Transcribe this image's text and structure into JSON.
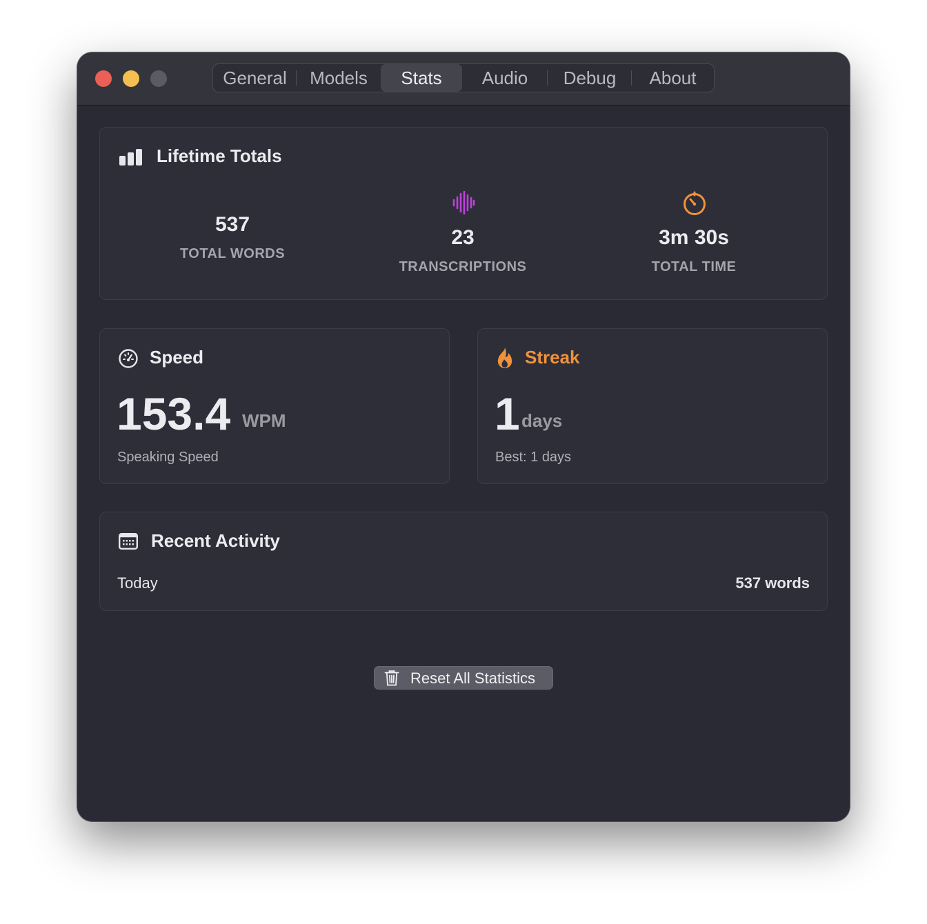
{
  "window": {
    "traffic_lights": [
      "close",
      "minimize",
      "zoom"
    ]
  },
  "tabs": [
    {
      "label": "General",
      "active": false
    },
    {
      "label": "Models",
      "active": false
    },
    {
      "label": "Stats",
      "active": true
    },
    {
      "label": "Audio",
      "active": false
    },
    {
      "label": "Debug",
      "active": false
    },
    {
      "label": "About",
      "active": false
    }
  ],
  "lifetime": {
    "title": "Lifetime Totals",
    "icon": "bar-chart-icon",
    "stats": [
      {
        "value": "537",
        "label": "TOTAL WORDS",
        "icon": ""
      },
      {
        "value": "23",
        "label": "TRANSCRIPTIONS",
        "icon": "waveform-icon",
        "icon_color": "#c03fe0"
      },
      {
        "value": "3m 30s",
        "label": "TOTAL TIME",
        "icon": "timer-icon",
        "icon_color": "#f0923a"
      }
    ]
  },
  "speed": {
    "title": "Speed",
    "icon": "speedometer-icon",
    "value": "153.4",
    "unit": "WPM",
    "subtitle": "Speaking Speed"
  },
  "streak": {
    "title": "Streak",
    "icon": "flame-icon",
    "accent": "#f0923a",
    "value": "1",
    "unit": "days",
    "best": "Best: 1 days"
  },
  "recent": {
    "title": "Recent Activity",
    "icon": "calendar-icon",
    "rows": [
      {
        "label": "Today",
        "value": "537 words"
      }
    ]
  },
  "reset_button": {
    "label": "Reset All Statistics",
    "icon": "trash-icon"
  }
}
